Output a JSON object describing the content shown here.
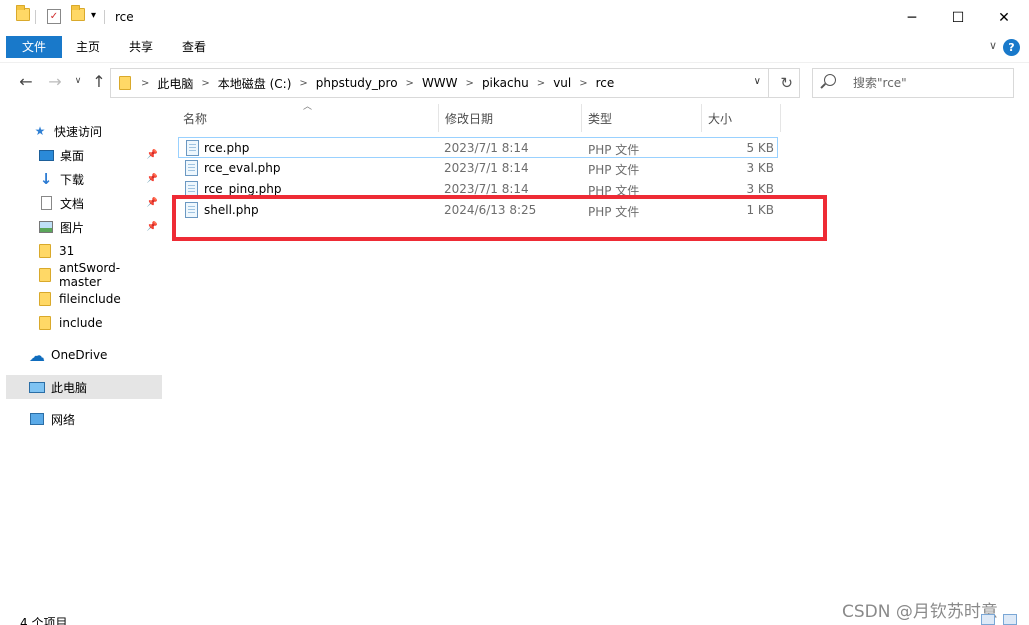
{
  "window": {
    "title": "rce",
    "minimize": "─",
    "maximize": "☐",
    "close": "✕"
  },
  "ribbon": {
    "tabs": [
      "文件",
      "主页",
      "共享",
      "查看"
    ],
    "collapse": "∨",
    "help": "?"
  },
  "address": {
    "crumbs": [
      "此电脑",
      "本地磁盘 (C:)",
      "phpstudy_pro",
      "WWW",
      "pikachu",
      "vul",
      "rce"
    ],
    "separator": ">",
    "search_placeholder": "搜索\"rce\""
  },
  "sidebar": {
    "items": [
      {
        "label": "快速访问",
        "icon": "star-icon"
      },
      {
        "label": "桌面",
        "icon": "desktop-icon",
        "pinned": true
      },
      {
        "label": "下载",
        "icon": "download-icon",
        "pinned": true
      },
      {
        "label": "文档",
        "icon": "document-icon",
        "pinned": true
      },
      {
        "label": "图片",
        "icon": "picture-icon",
        "pinned": true
      },
      {
        "label": "31",
        "icon": "folder-icon"
      },
      {
        "label": "antSword-master",
        "icon": "folder-icon"
      },
      {
        "label": "fileinclude",
        "icon": "folder-icon"
      },
      {
        "label": "include",
        "icon": "folder-icon"
      },
      {
        "label": "OneDrive",
        "icon": "cloud-icon"
      },
      {
        "label": "此电脑",
        "icon": "computer-icon",
        "selected": true
      },
      {
        "label": "网络",
        "icon": "network-icon"
      }
    ]
  },
  "columns": [
    "名称",
    "修改日期",
    "类型",
    "大小"
  ],
  "files": [
    {
      "name": "rce.php",
      "date": "2023/7/1 8:14",
      "type": "PHP 文件",
      "size": "5 KB"
    },
    {
      "name": "rce_eval.php",
      "date": "2023/7/1 8:14",
      "type": "PHP 文件",
      "size": "3 KB"
    },
    {
      "name": "rce_ping.php",
      "date": "2023/7/1 8:14",
      "type": "PHP 文件",
      "size": "3 KB"
    },
    {
      "name": "shell.php",
      "date": "2024/6/13 8:25",
      "type": "PHP 文件",
      "size": "1 KB"
    }
  ],
  "status": {
    "count": "4 个项目"
  },
  "watermark": "CSDN @月钦苏时意",
  "colors": {
    "accent": "#1979ca",
    "highlight": "#ee2b35",
    "selection": "#e5e5e5"
  }
}
